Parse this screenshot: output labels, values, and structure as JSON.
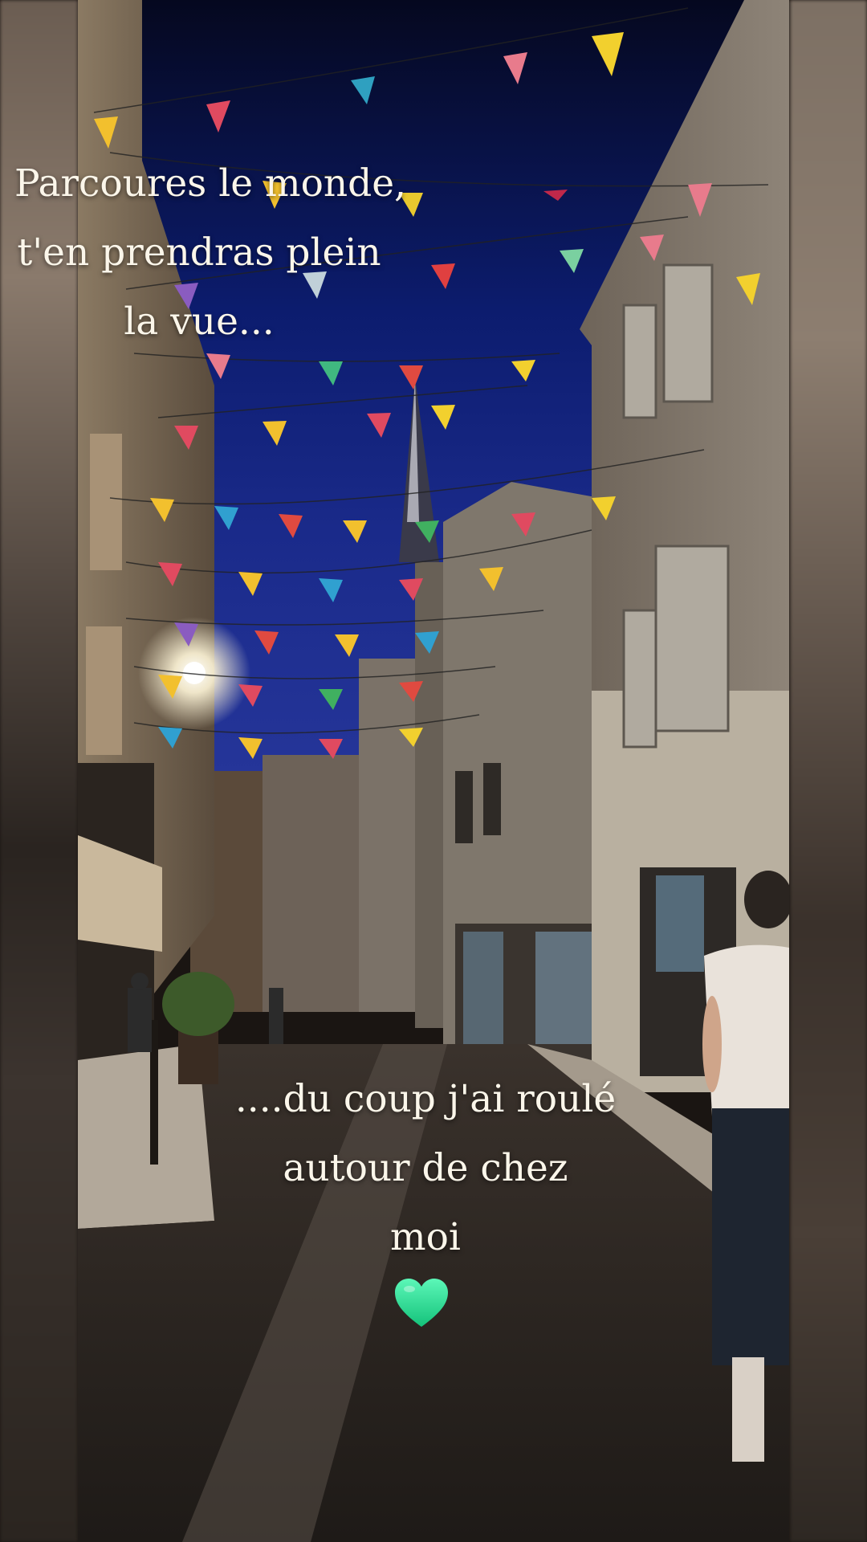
{
  "story": {
    "caption_top": "Parcoures le monde,\nt'en prendras plein\nla vue...",
    "caption_bottom": "....du coup j'ai roulé\nautour de chez\nmoi",
    "heart_emoji": "green-heart-icon",
    "colors": {
      "caption_text": "#fbf6ea",
      "heart": "#2ee59d",
      "night_sky": "#0b1a66"
    }
  }
}
